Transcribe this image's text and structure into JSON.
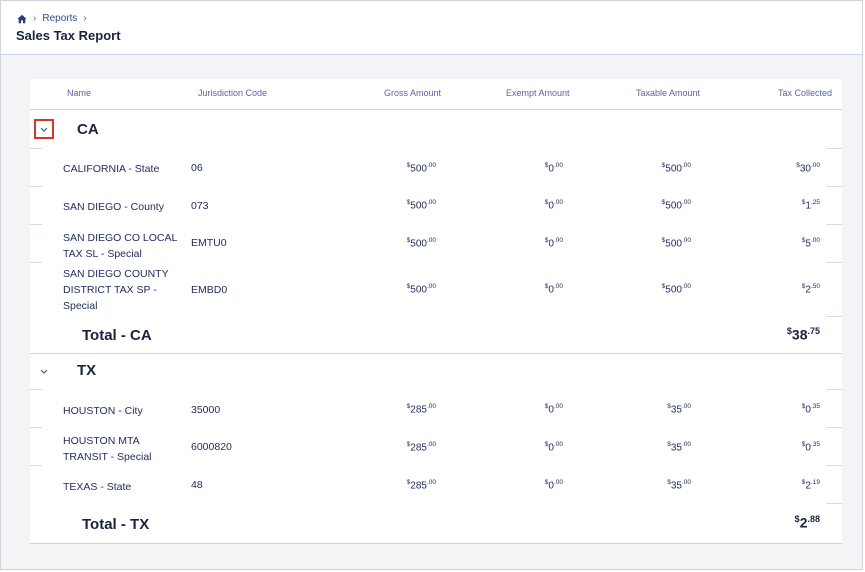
{
  "breadcrumb": {
    "home_icon": "home-icon",
    "reports": "Reports"
  },
  "page_title": "Sales Tax Report",
  "columns": [
    "Name",
    "Jurisdiction Code",
    "Gross Amount",
    "Exempt Amount",
    "Taxable Amount",
    "Tax Collected"
  ],
  "groups": [
    {
      "label": "CA",
      "rows": [
        {
          "name": "CALIFORNIA - State",
          "code": "06",
          "gross": [
            "$",
            "500",
            ".00"
          ],
          "exempt": [
            "$",
            "0",
            ".00"
          ],
          "taxable": [
            "$",
            "500",
            ".00"
          ],
          "tax": [
            "$",
            "30",
            ".00"
          ]
        },
        {
          "name": "SAN DIEGO - County",
          "code": "073",
          "gross": [
            "$",
            "500",
            ".00"
          ],
          "exempt": [
            "$",
            "0",
            ".00"
          ],
          "taxable": [
            "$",
            "500",
            ".00"
          ],
          "tax": [
            "$",
            "1",
            ".25"
          ]
        },
        {
          "name": "SAN DIEGO CO LOCAL TAX SL - Special",
          "code": "EMTU0",
          "gross": [
            "$",
            "500",
            ".00"
          ],
          "exempt": [
            "$",
            "0",
            ".00"
          ],
          "taxable": [
            "$",
            "500",
            ".00"
          ],
          "tax": [
            "$",
            "5",
            ".00"
          ]
        },
        {
          "name": "SAN DIEGO COUNTY DISTRICT TAX SP - Special",
          "code": "EMBD0",
          "gross": [
            "$",
            "500",
            ".00"
          ],
          "exempt": [
            "$",
            "0",
            ".00"
          ],
          "taxable": [
            "$",
            "500",
            ".00"
          ],
          "tax": [
            "$",
            "2",
            ".50"
          ]
        }
      ],
      "total_label": "Total - CA",
      "total": [
        "$",
        "38",
        ".75"
      ]
    },
    {
      "label": "TX",
      "rows": [
        {
          "name": "HOUSTON - City",
          "code": "35000",
          "gross": [
            "$",
            "285",
            ".00"
          ],
          "exempt": [
            "$",
            "0",
            ".00"
          ],
          "taxable": [
            "$",
            "35",
            ".00"
          ],
          "tax": [
            "$",
            "0",
            ".35"
          ]
        },
        {
          "name": "HOUSTON MTA TRANSIT - Special",
          "code": "6000820",
          "gross": [
            "$",
            "285",
            ".00"
          ],
          "exempt": [
            "$",
            "0",
            ".00"
          ],
          "taxable": [
            "$",
            "35",
            ".00"
          ],
          "tax": [
            "$",
            "0",
            ".35"
          ]
        },
        {
          "name": "TEXAS - State",
          "code": "48",
          "gross": [
            "$",
            "285",
            ".00"
          ],
          "exempt": [
            "$",
            "0",
            ".00"
          ],
          "taxable": [
            "$",
            "35",
            ".00"
          ],
          "tax": [
            "$",
            "2",
            ".19"
          ]
        }
      ],
      "total_label": "Total - TX",
      "total": [
        "$",
        "2",
        ".88"
      ]
    }
  ]
}
